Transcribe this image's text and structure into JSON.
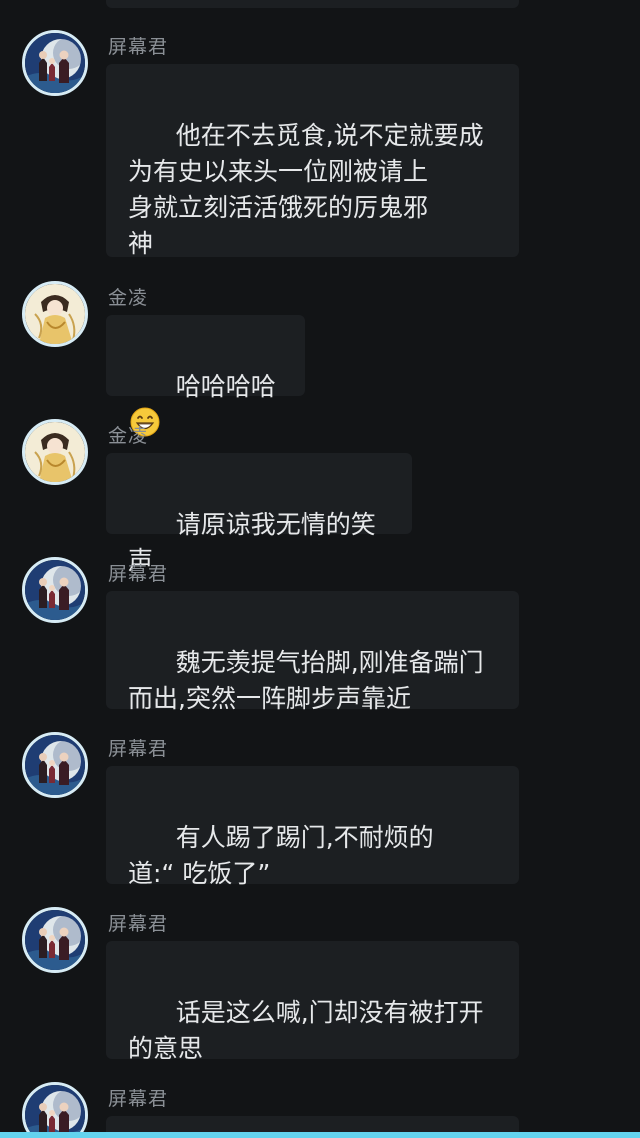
{
  "colors": {
    "background": "#121416",
    "bubble": "#1c1f22",
    "text": "#e6e8ea",
    "name": "#8a8f95",
    "accent_bar": "#63d3ee"
  },
  "messages": [
    {
      "sender": "屏幕君",
      "avatar": "moon-night-avatar",
      "text": "他在不去觅食,说不定就要成\n为有史以来头一位刚被请上\n身就立刻活活饿死的厉鬼邪\n神"
    },
    {
      "sender": "金凌",
      "avatar": "golden-robe-avatar",
      "text": "哈哈哈哈",
      "emoji": "grinning-face-emoji"
    },
    {
      "sender": "金凌",
      "avatar": "golden-robe-avatar",
      "text": "请原谅我无情的笑声"
    },
    {
      "sender": "屏幕君",
      "avatar": "moon-night-avatar",
      "text": "魏无羡提气抬脚,刚准备踹门\n而出,突然一阵脚步声靠近"
    },
    {
      "sender": "屏幕君",
      "avatar": "moon-night-avatar",
      "text": "有人踢了踢门,不耐烦的\n道:“ 吃饭了”"
    },
    {
      "sender": "屏幕君",
      "avatar": "moon-night-avatar",
      "text": "话是这么喊,门却没有被打开\n的意思"
    },
    {
      "sender": "屏幕君",
      "avatar": "moon-night-avatar",
      "text": ""
    }
  ]
}
